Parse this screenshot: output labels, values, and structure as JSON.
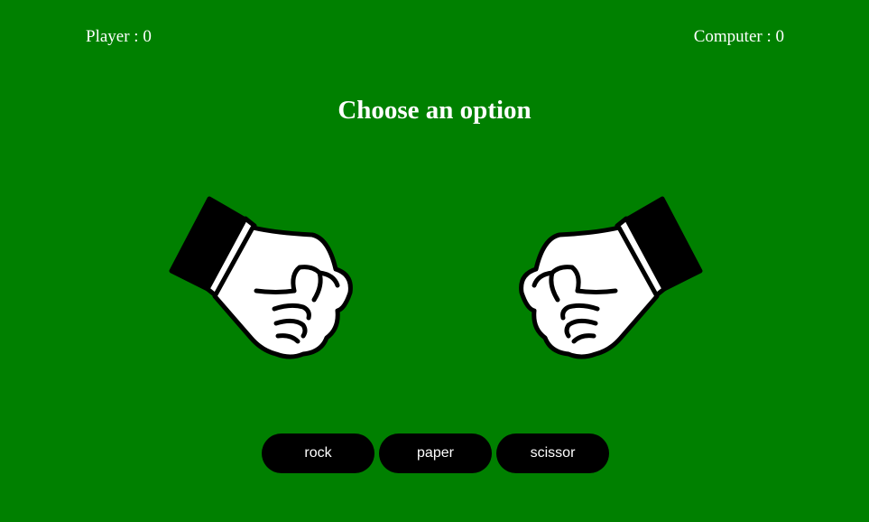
{
  "scoreboard": {
    "player_label": "Player : 0",
    "computer_label": "Computer : 0"
  },
  "title": "Choose an option",
  "hands": {
    "player_icon": "fist-icon",
    "computer_icon": "fist-icon"
  },
  "options": {
    "rock_label": "rock",
    "paper_label": "paper",
    "scissor_label": "scissor"
  },
  "colors": {
    "background": "#008000",
    "button": "#000000",
    "text": "#ffffff"
  }
}
